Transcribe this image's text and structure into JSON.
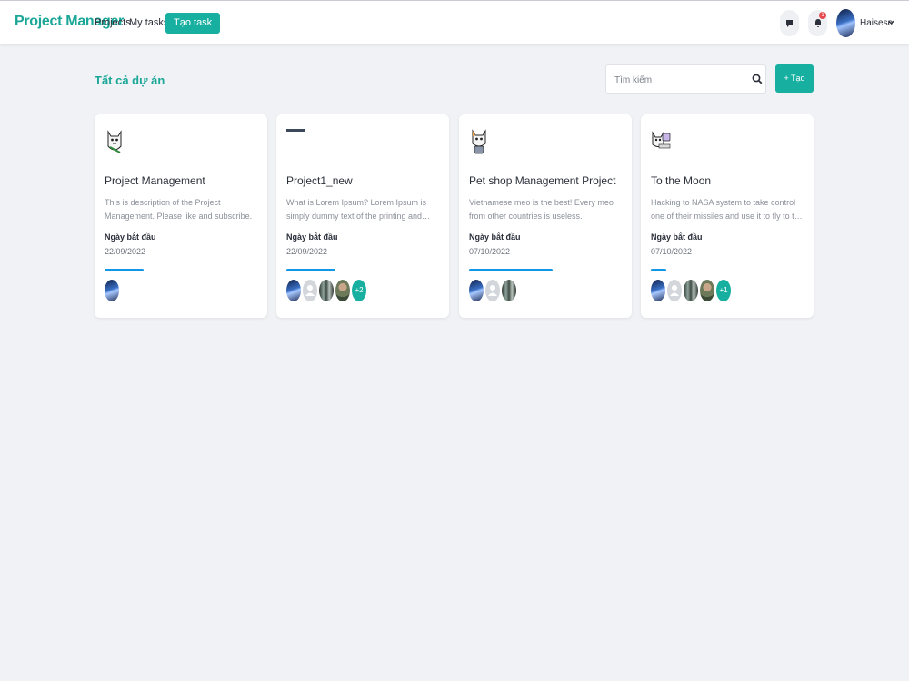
{
  "nav": {
    "brand": "Project Manager",
    "links": [
      "Projects",
      "My tasks"
    ],
    "task_button": "Tạo task",
    "notification_count": "1",
    "username": "Haisese"
  },
  "header": {
    "title": "Tất cả dự án",
    "search_placeholder": "Tìm kiếm",
    "create_button": "+ Tạo"
  },
  "colors": {
    "accent": "#17b0a0",
    "progress": "#1296e6",
    "badge": "#e5484d"
  },
  "projects": [
    {
      "title": "Project Management",
      "description": "This is description of the Project Management. Please like and subscribe.",
      "start_label": "Ngày bắt đầu",
      "start_date": "22/09/2022",
      "progress": 0.25,
      "members": [
        "blue"
      ],
      "more": ""
    },
    {
      "title": "Project1_new",
      "description": "What is Lorem Ipsum? Lorem Ipsum is simply dummy text of the printing and typesetting industry.",
      "start_label": "Ngày bắt đầu",
      "start_date": "22/09/2022",
      "progress": 0.32,
      "members": [
        "blue",
        "grey",
        "forest",
        "person"
      ],
      "more": "+2"
    },
    {
      "title": "Pet shop Management Project",
      "description": "Vietnamese meo is the best! Every meo from other countries is useless.",
      "start_label": "Ngày bắt đầu",
      "start_date": "07/10/2022",
      "progress": 0.54,
      "members": [
        "blue",
        "grey",
        "forest"
      ],
      "more": ""
    },
    {
      "title": "To the Moon",
      "description": "Hacking to NASA system to take control one of their missiles and use it to fly to the moon.",
      "start_label": "Ngày bắt đầu",
      "start_date": "07/10/2022",
      "progress": 0.1,
      "members": [
        "blue",
        "grey",
        "forest",
        "person"
      ],
      "more": "+1"
    }
  ]
}
